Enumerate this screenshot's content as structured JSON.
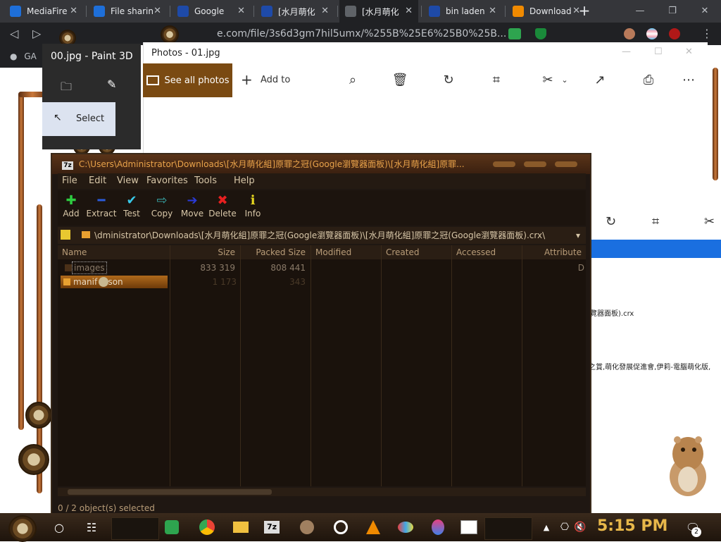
{
  "browser": {
    "tabs": [
      {
        "title": "MediaFire",
        "favicon": "mediafire-icon",
        "color": "#1e6fd9"
      },
      {
        "title": "File sharin",
        "favicon": "mediafire-icon",
        "color": "#1e6fd9"
      },
      {
        "title": "Google",
        "favicon": "mf-icon",
        "color": "#1e4aa8"
      },
      {
        "title": "[水月萌化",
        "favicon": "mf-icon",
        "color": "#1e4aa8"
      },
      {
        "title": "[水月萌化",
        "favicon": "globe-icon",
        "color": "#5f6368"
      },
      {
        "title": "bin laden",
        "favicon": "mf-icon",
        "color": "#1e4aa8"
      },
      {
        "title": "Download",
        "favicon": "vlc-icon",
        "color": "#f08a00"
      }
    ],
    "url": "e.com/file/3s6d3gm7hil5umx/%255B%25E6%25B0%25B...",
    "bookmark_label": "GA"
  },
  "paint3d": {
    "title": "00.jpg - Paint 3D",
    "select_label": "Select"
  },
  "photos": {
    "title": "Photos - 01.jpg",
    "see_all": "See all photos",
    "add_to": "Add to"
  },
  "sevenzip": {
    "title": "C:\\Users\\Administrator\\Downloads\\[水月萌化組]原罪之冠(Google瀏覽器面板)\\[水月萌化組]原罪...",
    "menu": [
      "File",
      "Edit",
      "View",
      "Favorites",
      "Tools",
      "Help"
    ],
    "toolbar": [
      {
        "label": "Add",
        "icon": "plus-icon",
        "color": "#2ecc40"
      },
      {
        "label": "Extract",
        "icon": "minus-icon",
        "color": "#2a5ad8"
      },
      {
        "label": "Test",
        "icon": "check-icon",
        "color": "#38c8e8"
      },
      {
        "label": "Copy",
        "icon": "copy-arrow-icon",
        "color": "#38a8a8"
      },
      {
        "label": "Move",
        "icon": "move-arrow-icon",
        "color": "#2a3ad8"
      },
      {
        "label": "Delete",
        "icon": "x-icon",
        "color": "#e82020"
      },
      {
        "label": "Info",
        "icon": "info-icon",
        "color": "#e8d820"
      }
    ],
    "address": "\\dministrator\\Downloads\\[水月萌化組]原罪之冠(Google瀏覽器面板)\\[水月萌化組]原罪之冠(Google瀏覽器面板).crx\\",
    "columns": [
      "Name",
      "Size",
      "Packed Size",
      "Modified",
      "Created",
      "Accessed",
      "Attribute"
    ],
    "rows": [
      {
        "name": "images",
        "size": "833 319",
        "packed": "808 441",
        "attr": "D"
      },
      {
        "name": "manif    son",
        "size": "1 173",
        "packed": "343",
        "attr": ""
      }
    ],
    "status": "0 / 2 object(s) selected"
  },
  "behind": {
    "line1": "覽器面板).crx",
    "line2": "之賞,萌化發展促進會,伊莉-電腦萌化版,"
  },
  "taskbar": {
    "clock": "5:15 PM",
    "notification_count": "2"
  }
}
